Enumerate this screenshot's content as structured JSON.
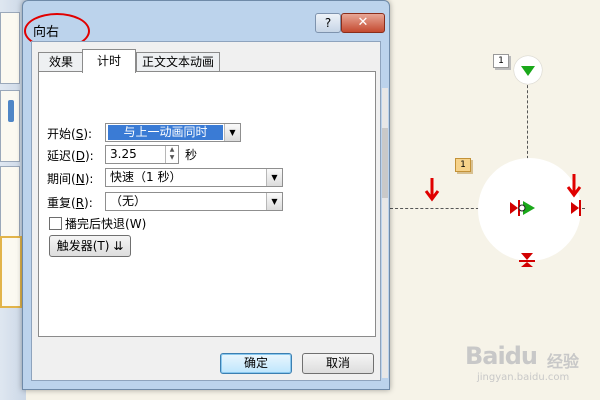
{
  "dialog": {
    "title": "向右",
    "help_glyph": "?",
    "close_glyph": "✕",
    "highlight_color": "#e10000"
  },
  "tabs": [
    {
      "label": "效果",
      "active": false
    },
    {
      "label": "计时",
      "active": true
    },
    {
      "label": "正文文本动画",
      "active": false
    }
  ],
  "timing": {
    "start": {
      "label": "开始",
      "key": "S",
      "value": "与上一动画同时"
    },
    "delay": {
      "label": "延迟",
      "key": "D",
      "value": "3.25",
      "unit": "秒"
    },
    "duration": {
      "label": "期间",
      "key": "N",
      "value": "快速（1 秒）"
    },
    "repeat": {
      "label": "重复",
      "key": "R",
      "value": "（无）"
    },
    "rewind": {
      "label": "播完后快退",
      "key": "W",
      "checked": false
    },
    "trigger": {
      "label": "触发器",
      "key": "T"
    }
  },
  "buttons": {
    "ok": "确定",
    "cancel": "取消"
  },
  "slide": {
    "animation_tag_1": "1",
    "animation_tag_2": "1"
  },
  "watermark": {
    "brand": "Baidu",
    "product": "经验",
    "url": "jingyan.baidu.com"
  },
  "colors": {
    "annotation_red": "#e00000",
    "path_green": "#1aa81a",
    "selection_blue": "#3a7bd5"
  }
}
